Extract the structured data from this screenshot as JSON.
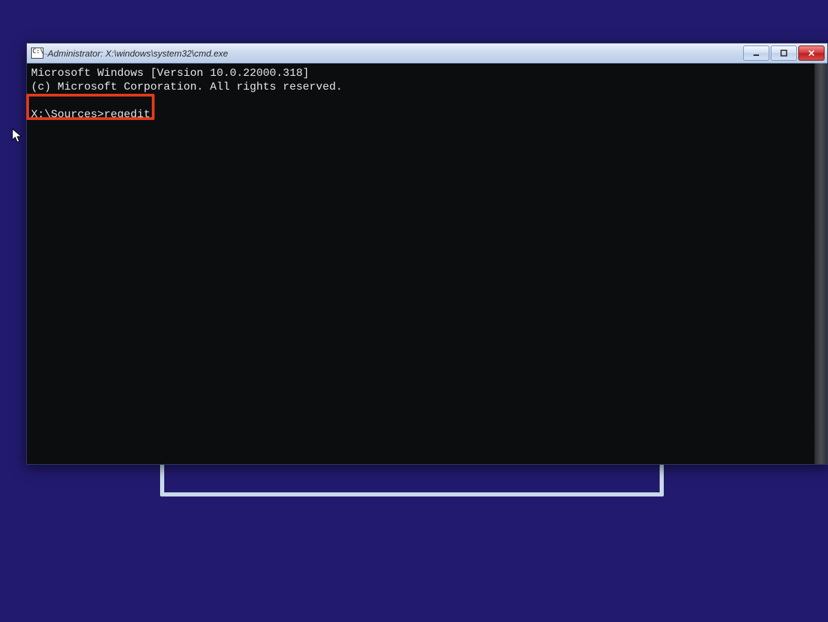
{
  "window": {
    "title": "Administrator: X:\\windows\\system32\\cmd.exe"
  },
  "terminal": {
    "line1": "Microsoft Windows [Version 10.0.22000.318]",
    "line2": "(c) Microsoft Corporation. All rights reserved.",
    "blank": "",
    "prompt": "X:\\Sources>",
    "command": "regedit"
  },
  "highlight": {
    "target": "prompt-line"
  }
}
